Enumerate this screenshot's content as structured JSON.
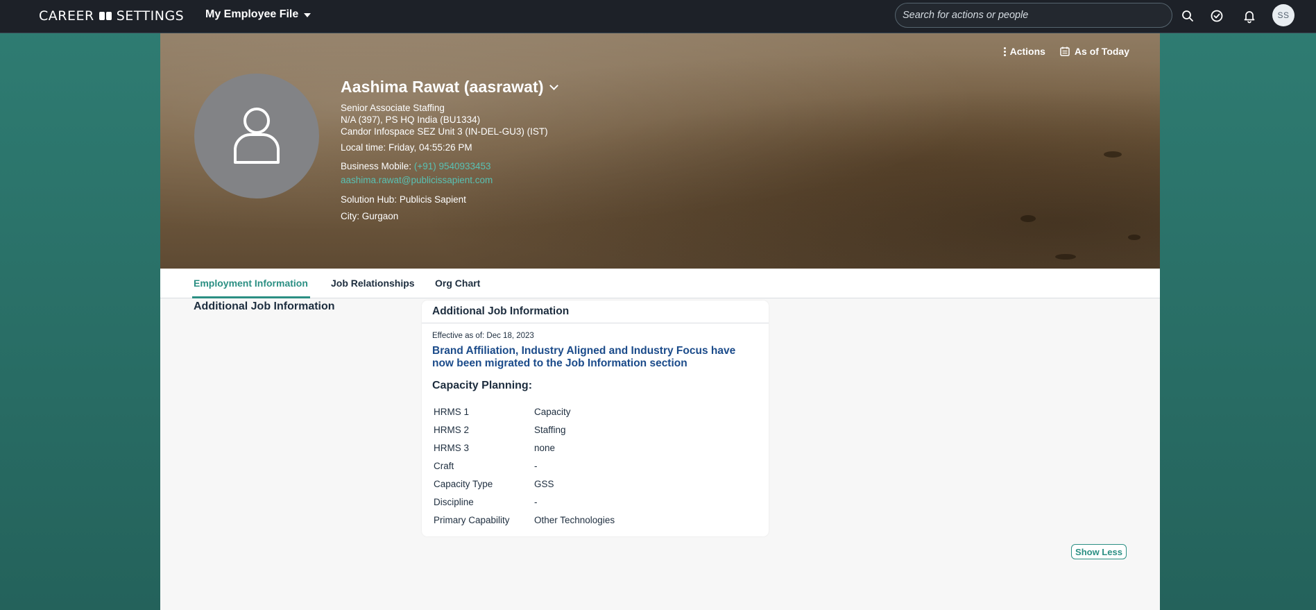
{
  "header": {
    "brand_left": "CAREER",
    "brand_right": "SETTINGS",
    "module": "My Employee File",
    "search_placeholder": "Search for actions or people",
    "avatar_initials": "SS"
  },
  "hero": {
    "actions_label": "Actions",
    "date_label": "As of Today",
    "name": "Aashima Rawat (aasrawat)",
    "title": "Senior Associate Staffing",
    "department": "N/A (397), PS HQ India (BU1334)",
    "location": "Candor Infospace SEZ Unit 3 (IN-DEL-GU3) (IST)",
    "local_time_label": "Local time:",
    "local_time_value": "Friday, 04:55:26 PM",
    "mobile_label": "Business Mobile:",
    "mobile_value": "(+91) 9540933453",
    "email": "aashima.rawat@publicissapient.com",
    "hub_label": "Solution Hub:",
    "hub_value": "Publicis Sapient",
    "city_label": "City:",
    "city_value": "Gurgaon"
  },
  "tabs": [
    {
      "label": "Employment Information"
    },
    {
      "label": "Job Relationships"
    },
    {
      "label": "Org Chart"
    }
  ],
  "section": {
    "title": "Additional Job Information"
  },
  "card": {
    "title": "Additional Job Information",
    "effective": "Effective as of: Dec 18, 2023",
    "notice": "Brand Affiliation, Industry Aligned and Industry Focus have now been migrated to the Job Information section",
    "capacity_title": "Capacity Planning:",
    "rows": [
      {
        "k": "HRMS 1",
        "v": "Capacity"
      },
      {
        "k": "HRMS 2",
        "v": "Staffing"
      },
      {
        "k": "HRMS 3",
        "v": "none"
      },
      {
        "k": "Craft",
        "v": "-"
      },
      {
        "k": "Capacity Type",
        "v": "GSS"
      },
      {
        "k": "Discipline",
        "v": "-"
      },
      {
        "k": "Primary Capability",
        "v": "Other Technologies"
      }
    ]
  },
  "show_less": "Show Less",
  "colors": {
    "topbar": "#1d2128",
    "accent": "#2b8f83",
    "link": "#59c1b3",
    "notice": "#1b4b8a",
    "page_bg": "#2f7d73"
  }
}
